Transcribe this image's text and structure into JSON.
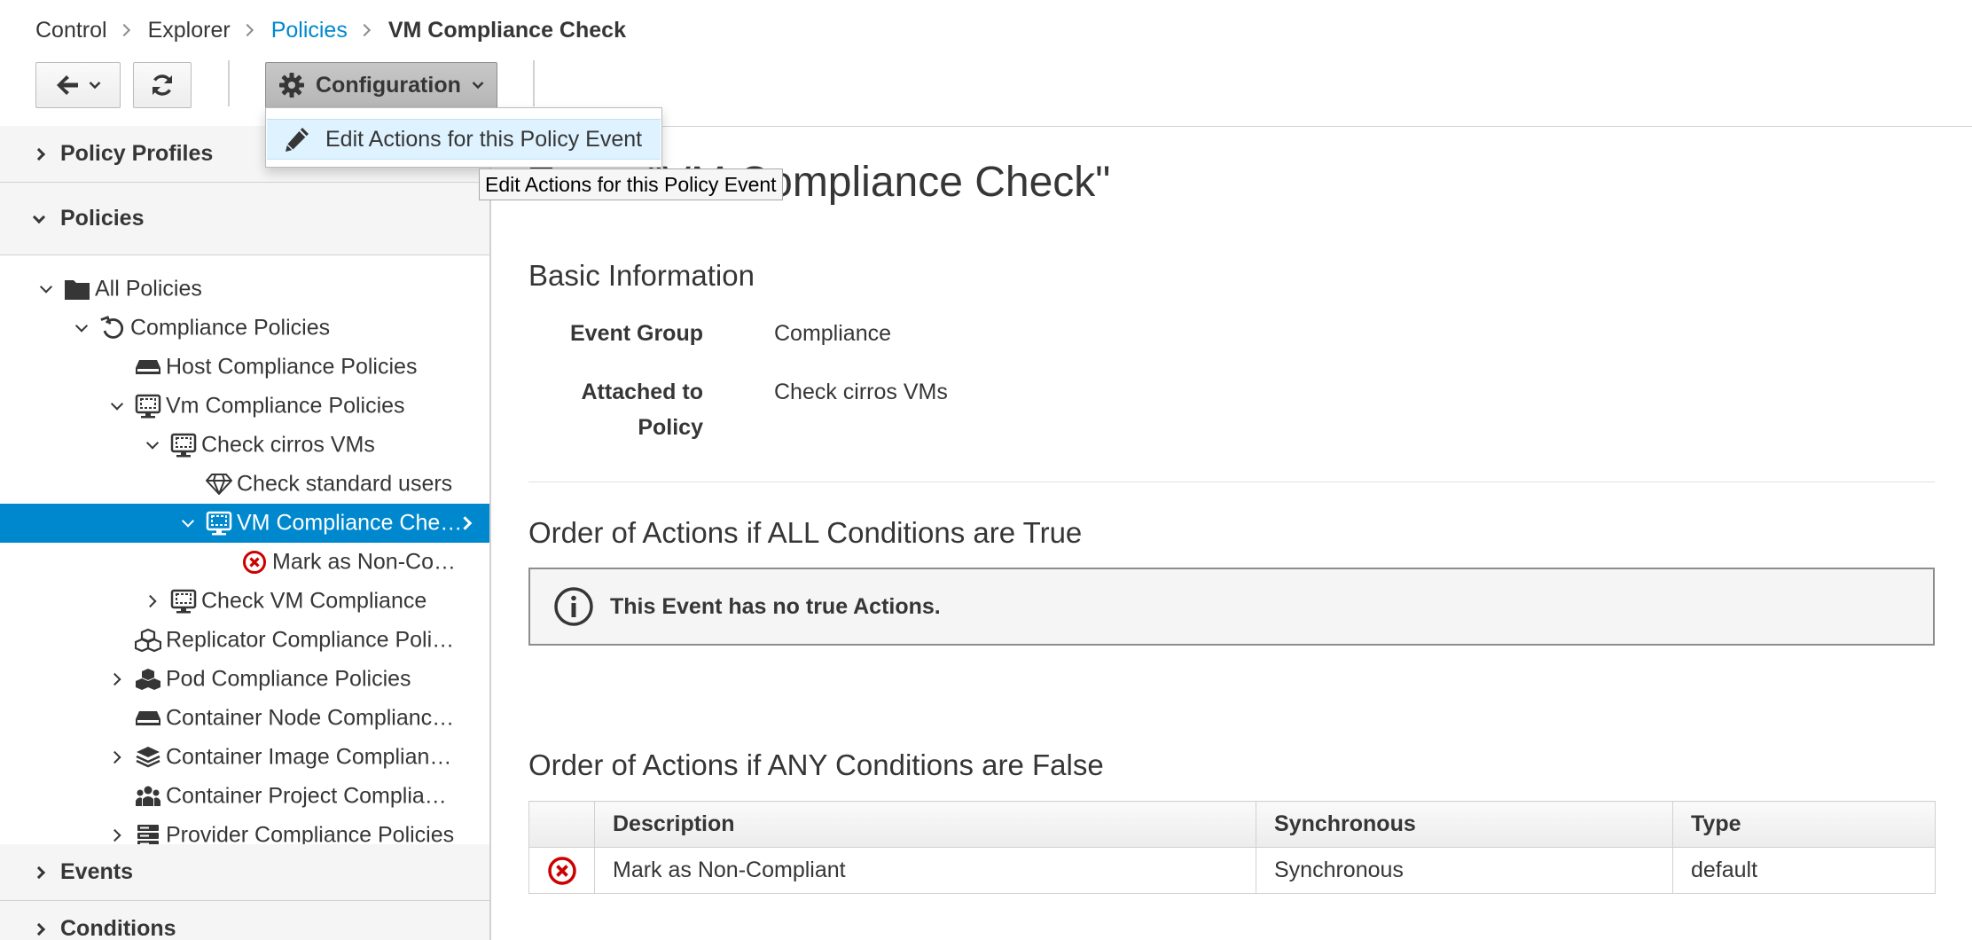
{
  "breadcrumb": {
    "items": [
      "Control",
      "Explorer",
      "Policies"
    ],
    "current": "VM Compliance Check"
  },
  "toolbar": {
    "configuration_label": "Configuration"
  },
  "dropdown": {
    "items": [
      {
        "label": "Edit Actions for this Policy Event",
        "icon": "pencil-icon"
      }
    ]
  },
  "tooltip": "Edit Actions for this Policy Event",
  "sidebar": {
    "accordions": {
      "policy_profiles": "Policy Profiles",
      "policies": "Policies",
      "events": "Events",
      "conditions": "Conditions"
    },
    "tree": [
      {
        "label": "All Policies",
        "icon": "folder-icon"
      },
      {
        "label": "Compliance Policies",
        "icon": "history-icon"
      },
      {
        "label": "Host Compliance Policies",
        "icon": "host-icon"
      },
      {
        "label": "Vm Compliance Policies",
        "icon": "vm-icon"
      },
      {
        "label": "Check cirros VMs",
        "icon": "vm-icon"
      },
      {
        "label": "Check standard users",
        "icon": "diamond-icon"
      },
      {
        "label": "VM Compliance Che…",
        "icon": "vm-icon",
        "selected": true
      },
      {
        "label": "Mark as Non-Co…",
        "icon": "error-circle-icon"
      },
      {
        "label": "Check VM Compliance",
        "icon": "vm-icon"
      },
      {
        "label": "Replicator Compliance Poli…",
        "icon": "cubes-icon"
      },
      {
        "label": "Pod Compliance Policies",
        "icon": "cubes-icon"
      },
      {
        "label": "Container Node Complianc…",
        "icon": "host-icon"
      },
      {
        "label": "Container Image Complian…",
        "icon": "layers-icon"
      },
      {
        "label": "Container Project Complia…",
        "icon": "users-icon"
      },
      {
        "label": "Provider Compliance Policies",
        "icon": "server-stack-icon"
      }
    ]
  },
  "main": {
    "title": "Event \"VM Compliance Check\"",
    "basic_info": {
      "heading": "Basic Information",
      "event_group_label": "Event Group",
      "event_group_value": "Compliance",
      "attached_label_1": "Attached to",
      "attached_label_2": "Policy",
      "attached_value": "Check cirros VMs"
    },
    "true_actions": {
      "heading": "Order of Actions if ALL Conditions are True",
      "alert": "This Event has no true Actions."
    },
    "false_actions": {
      "heading": "Order of Actions if ANY Conditions are False",
      "columns": [
        "Description",
        "Synchronous",
        "Type"
      ],
      "rows": [
        {
          "icon": "error-circle-icon",
          "description": "Mark as Non-Compliant",
          "synchronous": "Synchronous",
          "type": "default"
        }
      ]
    }
  },
  "colors": {
    "accent": "#0088ce",
    "error": "#cc0000",
    "selected_text": "#ffffff"
  }
}
